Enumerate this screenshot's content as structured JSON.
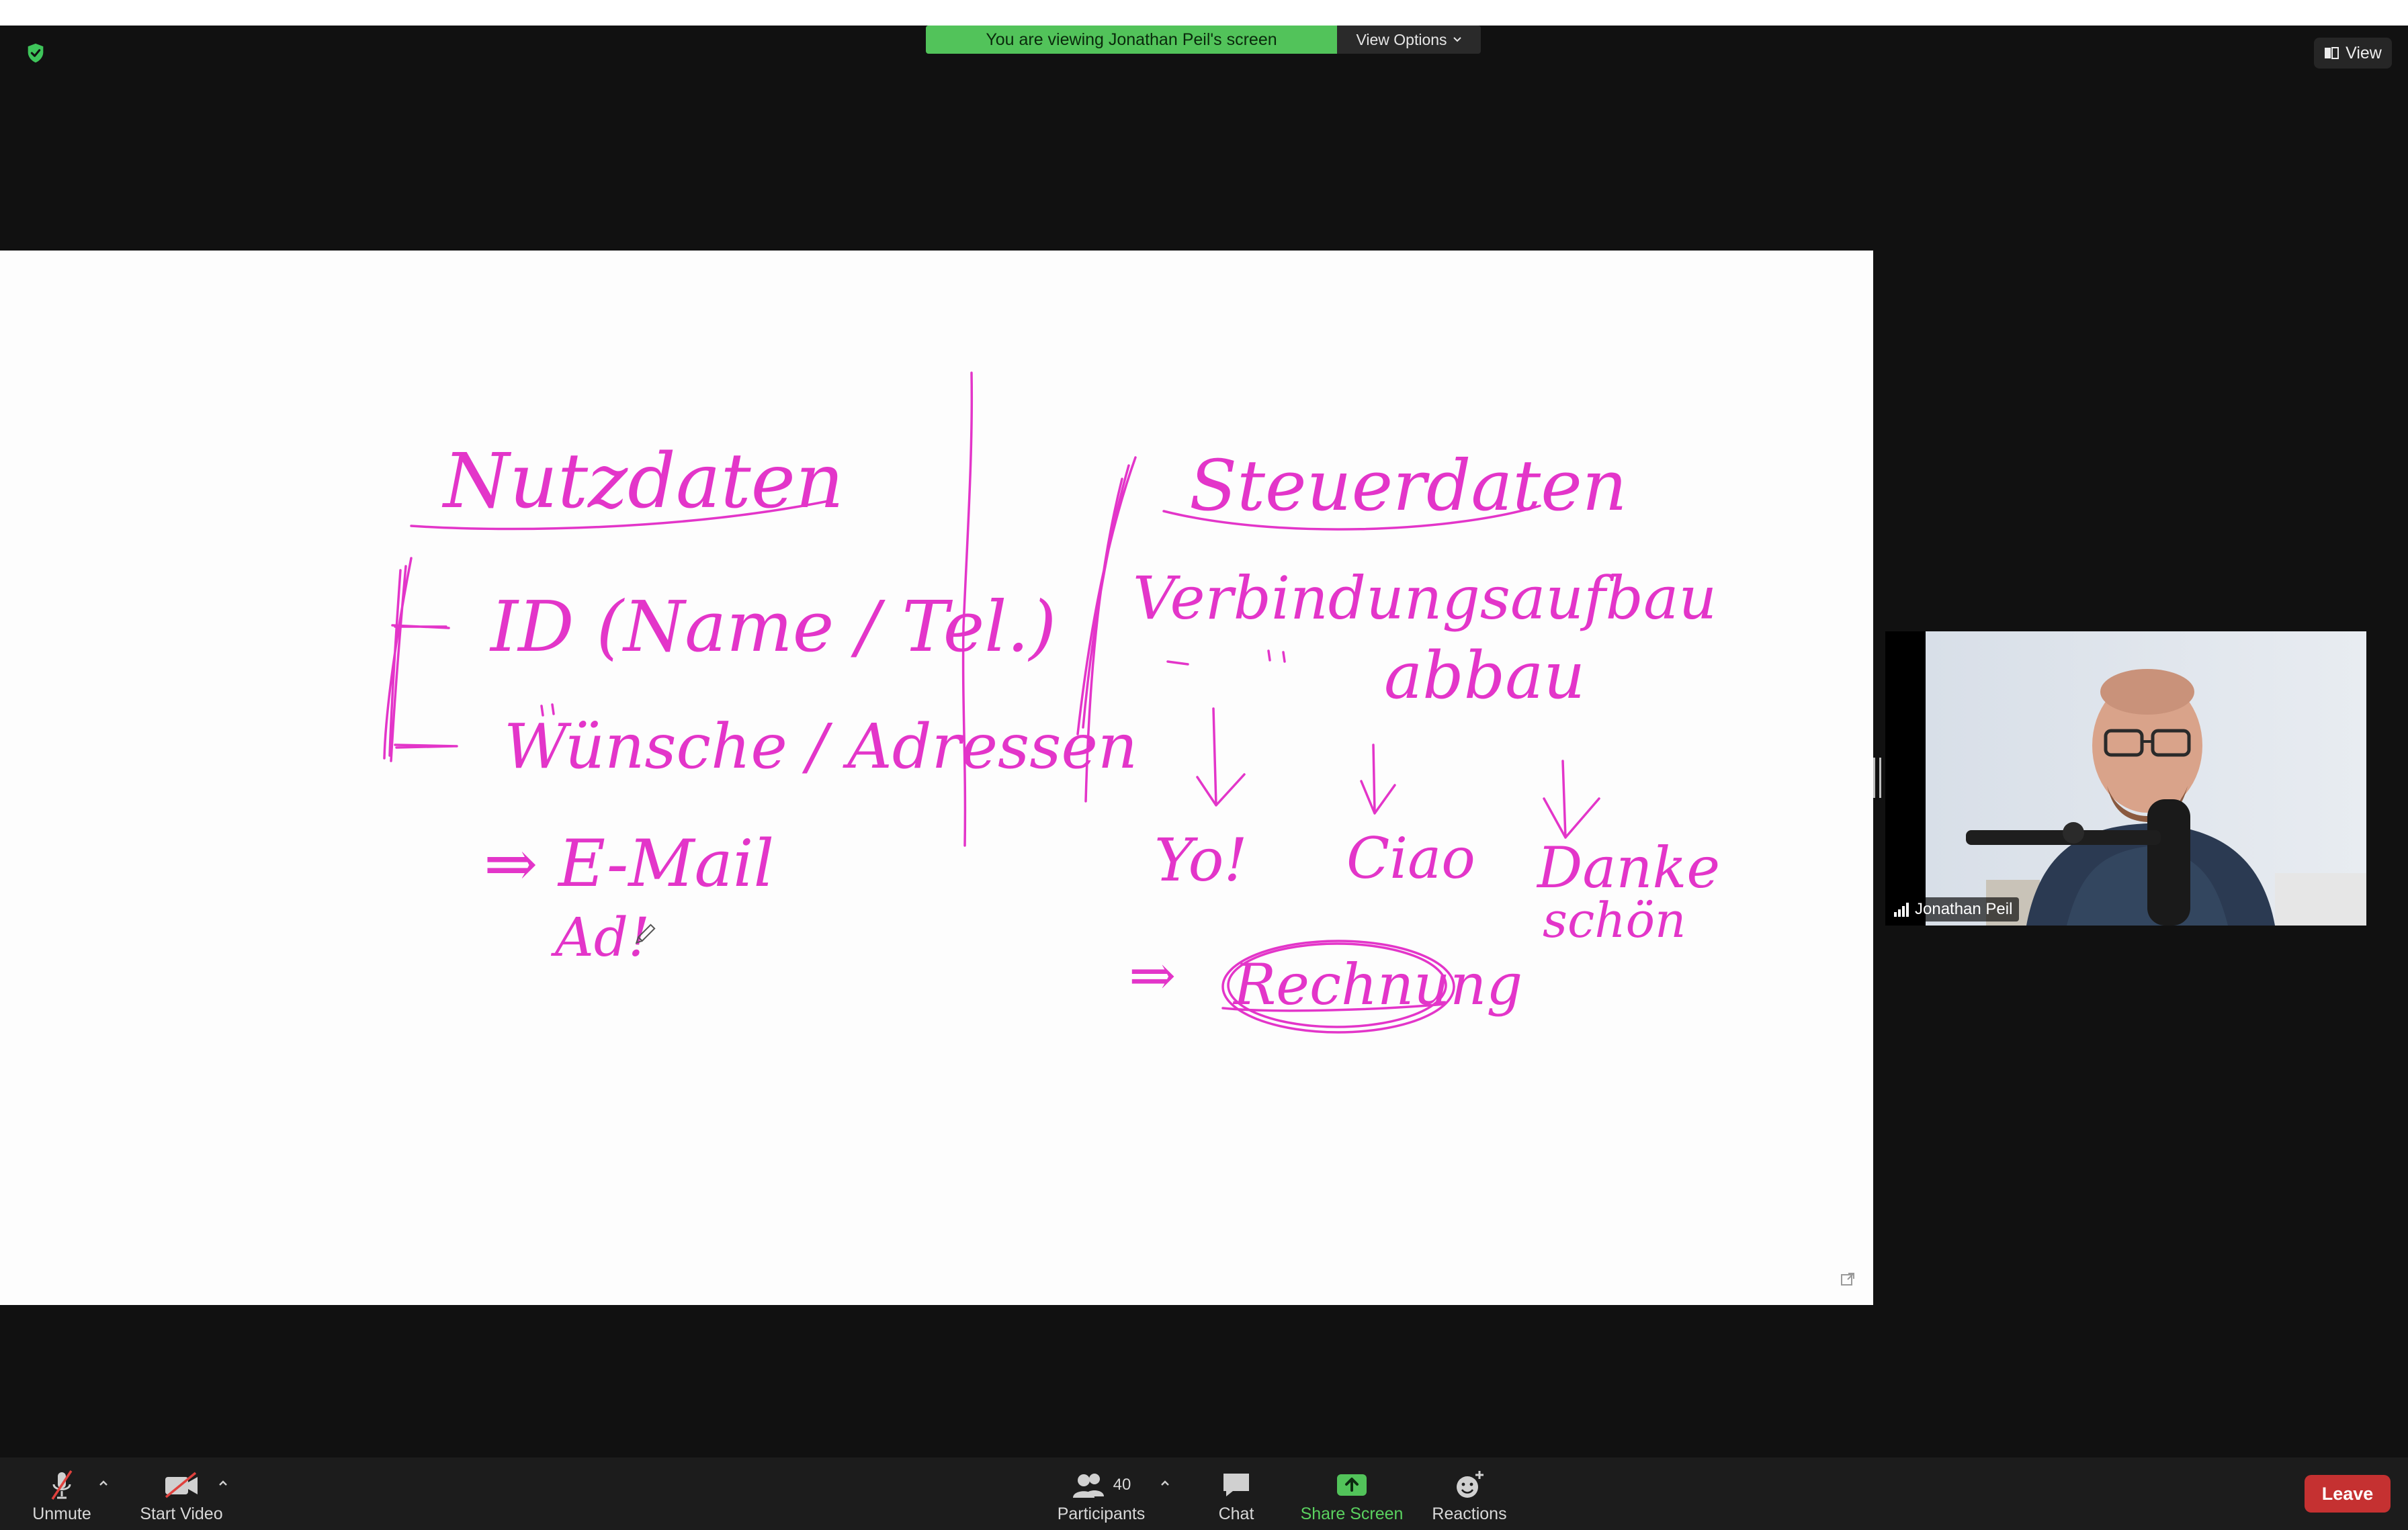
{
  "banner": {
    "text": "You are viewing Jonathan Peil's screen",
    "view_options": "View Options"
  },
  "view_button": {
    "label": "View"
  },
  "video": {
    "participant_name": "Jonathan Peil"
  },
  "toolbar": {
    "unmute": "Unmute",
    "start_video": "Start Video",
    "participants": "Participants",
    "participant_count": "40",
    "chat": "Chat",
    "share_screen": "Share Screen",
    "reactions": "Reactions",
    "leave": "Leave"
  },
  "whiteboard": {
    "left_heading": "Nutzdaten",
    "left_line_1": "ID (Name / Tel.)",
    "left_line_2": "Wünsche / Adressen",
    "left_line_3": "⇒ E-Mail",
    "left_line_4": "Ad!",
    "right_heading": "Steuerdaten",
    "right_line_1": "Verbindungsaufbau",
    "right_line_2": "abbau",
    "right_item_1": "Yo!",
    "right_item_2": "Ciao",
    "right_item_3a": "Danke",
    "right_item_3b": "schön",
    "right_result": "Rechnung",
    "ink_color": "#e335c9"
  },
  "colors": {
    "accent_green": "#52c35a",
    "leave_red": "#c53131"
  }
}
